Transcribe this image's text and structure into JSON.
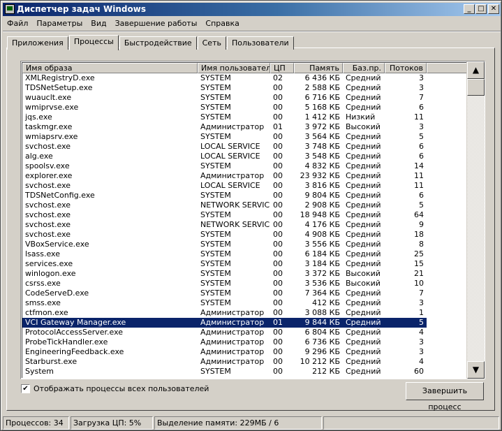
{
  "window": {
    "title": "Диспетчер задач Windows",
    "minimize": "_",
    "maximize": "□",
    "close": "✕"
  },
  "menu": [
    "Файл",
    "Параметры",
    "Вид",
    "Завершение работы",
    "Справка"
  ],
  "tabs": [
    "Приложения",
    "Процессы",
    "Быстродействие",
    "Сеть",
    "Пользователи"
  ],
  "active_tab": 1,
  "columns": [
    "Имя образа",
    "Имя пользователя",
    "ЦП",
    "Память",
    "Баз.пр.",
    "Потоков"
  ],
  "selected_row": 25,
  "rows": [
    [
      "XMLRegistryD.exe",
      "SYSTEM",
      "02",
      "6 436 КБ",
      "Средний",
      "3"
    ],
    [
      "TDSNetSetup.exe",
      "SYSTEM",
      "00",
      "2 588 КБ",
      "Средний",
      "3"
    ],
    [
      "wuauclt.exe",
      "SYSTEM",
      "00",
      "6 716 КБ",
      "Средний",
      "7"
    ],
    [
      "wmiprvse.exe",
      "SYSTEM",
      "00",
      "5 168 КБ",
      "Средний",
      "6"
    ],
    [
      "jqs.exe",
      "SYSTEM",
      "00",
      "1 412 КБ",
      "Низкий",
      "11"
    ],
    [
      "taskmgr.exe",
      "Администратор",
      "01",
      "3 972 КБ",
      "Высокий",
      "3"
    ],
    [
      "wmiapsrv.exe",
      "SYSTEM",
      "00",
      "3 564 КБ",
      "Средний",
      "5"
    ],
    [
      "svchost.exe",
      "LOCAL SERVICE",
      "00",
      "3 748 КБ",
      "Средний",
      "6"
    ],
    [
      "alg.exe",
      "LOCAL SERVICE",
      "00",
      "3 548 КБ",
      "Средний",
      "6"
    ],
    [
      "spoolsv.exe",
      "SYSTEM",
      "00",
      "4 832 КБ",
      "Средний",
      "14"
    ],
    [
      "explorer.exe",
      "Администратор",
      "00",
      "23 932 КБ",
      "Средний",
      "11"
    ],
    [
      "svchost.exe",
      "LOCAL SERVICE",
      "00",
      "3 816 КБ",
      "Средний",
      "11"
    ],
    [
      "TDSNetConfig.exe",
      "SYSTEM",
      "00",
      "9 804 КБ",
      "Средний",
      "6"
    ],
    [
      "svchost.exe",
      "NETWORK SERVICE",
      "00",
      "2 908 КБ",
      "Средний",
      "5"
    ],
    [
      "svchost.exe",
      "SYSTEM",
      "00",
      "18 948 КБ",
      "Средний",
      "64"
    ],
    [
      "svchost.exe",
      "NETWORK SERVICE",
      "00",
      "4 176 КБ",
      "Средний",
      "9"
    ],
    [
      "svchost.exe",
      "SYSTEM",
      "00",
      "4 908 КБ",
      "Средний",
      "18"
    ],
    [
      "VBoxService.exe",
      "SYSTEM",
      "00",
      "3 556 КБ",
      "Средний",
      "8"
    ],
    [
      "lsass.exe",
      "SYSTEM",
      "00",
      "6 184 КБ",
      "Средний",
      "25"
    ],
    [
      "services.exe",
      "SYSTEM",
      "00",
      "3 184 КБ",
      "Средний",
      "15"
    ],
    [
      "winlogon.exe",
      "SYSTEM",
      "00",
      "3 372 КБ",
      "Высокий",
      "21"
    ],
    [
      "csrss.exe",
      "SYSTEM",
      "00",
      "3 536 КБ",
      "Высокий",
      "10"
    ],
    [
      "CodeServeD.exe",
      "SYSTEM",
      "00",
      "7 364 КБ",
      "Средний",
      "7"
    ],
    [
      "smss.exe",
      "SYSTEM",
      "00",
      "412 КБ",
      "Средний",
      "3"
    ],
    [
      "ctfmon.exe",
      "Администратор",
      "00",
      "3 088 КБ",
      "Средний",
      "1"
    ],
    [
      "VCI Gateway Manager.exe",
      "Администратор",
      "01",
      "9 844 КБ",
      "Средний",
      "5"
    ],
    [
      "ProtocolAccessServer.exe",
      "Администратор",
      "00",
      "6 804 КБ",
      "Средний",
      "4"
    ],
    [
      "ProbeTickHandler.exe",
      "Администратор",
      "00",
      "6 736 КБ",
      "Средний",
      "3"
    ],
    [
      "EngineeringFeedback.exe",
      "Администратор",
      "00",
      "9 296 КБ",
      "Средний",
      "3"
    ],
    [
      "Starburst.exe",
      "Администратор",
      "00",
      "10 212 КБ",
      "Средний",
      "4"
    ],
    [
      "System",
      "SYSTEM",
      "00",
      "212 КБ",
      "Средний",
      "60"
    ]
  ],
  "show_all_users": {
    "label": "Отображать процессы всех пользователей",
    "checked": true
  },
  "end_process_label": "Завершить процесс",
  "status": {
    "processes": "Процессов: 34",
    "cpu": "Загрузка ЦП: 5%",
    "memory": "Выделение памяти: 229МБ / 6"
  },
  "colors": {
    "selection": "#0a246a",
    "face": "#d4d0c8"
  }
}
